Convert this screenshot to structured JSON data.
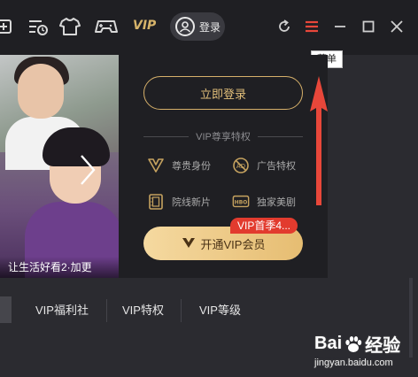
{
  "topbar": {
    "icons": [
      "add-video-icon",
      "history-icon",
      "tshirt-icon",
      "gamepad-icon"
    ],
    "vip_label": "VIP",
    "login_label": "登录",
    "window_icons": [
      "refresh-icon",
      "menu-icon",
      "minimize-icon",
      "maximize-icon",
      "close-icon"
    ]
  },
  "tooltip": {
    "text": "菜单"
  },
  "banner": {
    "caption": "让生活好看2·加更"
  },
  "vip_panel": {
    "login_button": "立即登录",
    "section_title": "VIP尊享特权",
    "perks": [
      {
        "icon": "vip-crown-icon",
        "label": "尊贵身份"
      },
      {
        "icon": "no-ads-icon",
        "label": "广告特权"
      },
      {
        "icon": "film-icon",
        "label": "院线新片"
      },
      {
        "icon": "hbo-icon",
        "label": "独家美剧"
      }
    ],
    "open_button": "开通VIP会员",
    "promo_badge": "VIP首季4..."
  },
  "bottom_nav": {
    "items": [
      "VIP福利社",
      "VIP特权",
      "VIP等级"
    ]
  },
  "watermark": {
    "main_left": "Bai",
    "main_right": "经验",
    "sub": "jingyan.baidu.com"
  },
  "colors": {
    "gold": "#d6b06a",
    "menu_red": "#e8473a",
    "promo_red": "#e23b2e",
    "panel_bg": "#1f1f23"
  }
}
